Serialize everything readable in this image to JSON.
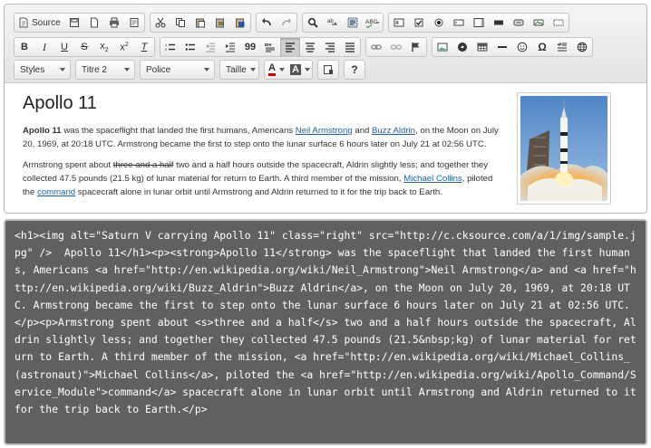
{
  "toolbar": {
    "source_label": "Source",
    "styles_label": "Styles",
    "format_value": "Titre 2",
    "font_label": "Police",
    "size_label": "Taille",
    "font_color_label": "A",
    "bg_color_label": "A",
    "help_label": "?",
    "strikethrough_glyph": "S",
    "clear_format_glyph": "T",
    "quote_glyph": "99",
    "omega_glyph": "Ω"
  },
  "document": {
    "title": "Apollo 11",
    "p1_bold": "Apollo 11",
    "p1_text1": " was the spaceflight that landed the first humans, Americans ",
    "p1_link1": "Neil Armstrong",
    "p1_text2": " and ",
    "p1_link2": "Buzz Aldrin",
    "p1_text3": ", on the Moon on July 20, 1969, at 20:18 UTC. Armstrong became the first to step onto the lunar surface 6 hours later on July 21 at 02:56 UTC.",
    "p2_text1": "Armstrong spent about ",
    "p2_strike": "three and a half",
    "p2_text2": " two and a half hours outside the spacecraft, Aldrin slightly less; and together they collected 47.5 pounds (21.5 kg) of lunar material for return to Earth. A third member of the mission, ",
    "p2_link1": "Michael Collins",
    "p2_text3": ", piloted the ",
    "p2_link2": "command",
    "p2_text4": " spacecraft alone in lunar orbit until Armstrong and Aldrin returned to it for the trip back to Earth.",
    "image_alt": "Saturn V carrying Apollo 11"
  },
  "source_code": "<h1><img alt=\"Saturn V carrying Apollo 11\" class=\"right\" src=\"http://c.cksource.com/a/1/img/sample.jpg\" />  Apollo 11</h1><p><strong>Apollo 11</strong> was the spaceflight that landed the first humans, Americans <a href=\"http://en.wikipedia.org/wiki/Neil_Armstrong\">Neil Armstrong</a> and <a href=\"http://en.wikipedia.org/wiki/Buzz_Aldrin\">Buzz Aldrin</a>, on the Moon on July 20, 1969, at 20:18 UTC. Armstrong became the first to step onto the lunar surface 6 hours later on July 21 at 02:56 UTC.</p><p>Armstrong spent about <s>three and a half</s> two and a half hours outside the spacecraft, Aldrin slightly less; and together they collected 47.5 pounds (21.5&nbsp;kg) of lunar material for return to Earth. A third member of the mission, <a href=\"http://en.wikipedia.org/wiki/Michael_Collins_(astronaut)\">Michael Collins</a>, piloted the <a href=\"http://en.wikipedia.org/wiki/Apollo_Command/Service_Module\">command</a> spacecraft alone in lunar orbit until Armstrong and Aldrin returned to it for the trip back to Earth.</p>"
}
